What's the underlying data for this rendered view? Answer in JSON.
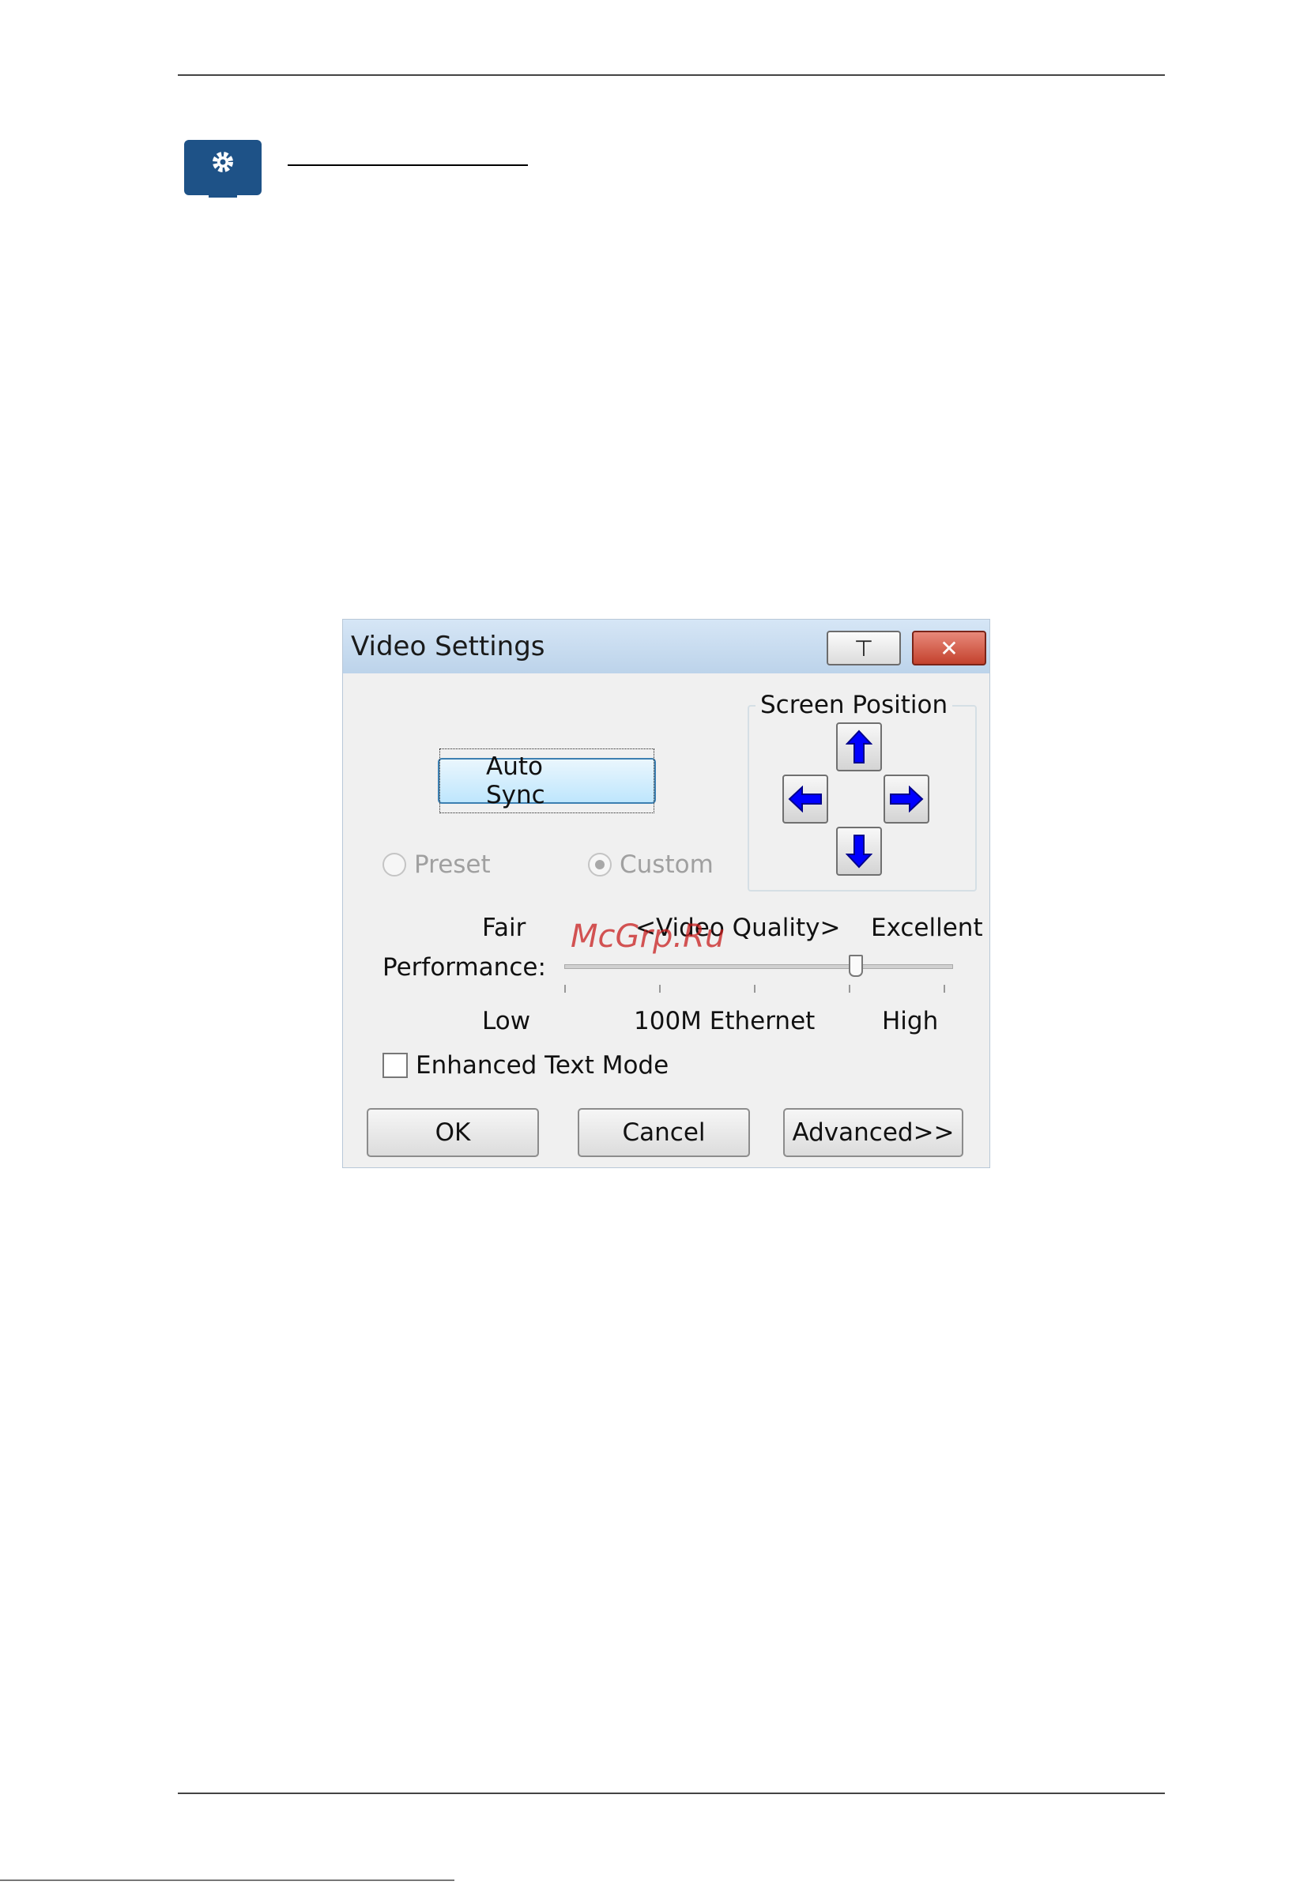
{
  "dialog": {
    "title": "Video Settings",
    "pin_label": "⊤",
    "close_label": "✕",
    "auto_sync_label": "Auto Sync",
    "screen_position": {
      "label": "Screen Position",
      "icons": [
        "arrow-up-icon",
        "arrow-left-icon",
        "arrow-right-icon",
        "arrow-down-icon"
      ]
    },
    "mode_options": [
      {
        "label": "Preset",
        "selected": false,
        "enabled": false
      },
      {
        "label": "Custom",
        "selected": true,
        "enabled": false
      }
    ],
    "quality": {
      "fair_label": "Fair",
      "center_label": "<Video Quality>",
      "excellent_label": "Excellent"
    },
    "performance": {
      "label": "Performance:",
      "low_label": "Low",
      "mid_label": "100M Ethernet",
      "high_label": "High",
      "slider_level": 0.75,
      "tick_count": 5
    },
    "enhanced_text_mode": {
      "label": "Enhanced Text Mode",
      "checked": false
    },
    "buttons": {
      "ok": "OK",
      "cancel": "Cancel",
      "advanced": "Advanced>>"
    }
  },
  "watermark": "McGrp.Ru",
  "colors": {
    "icon_bg": "#1e5287",
    "arrow_blue": "#0000ff",
    "watermark_red": "#c81e1e"
  }
}
